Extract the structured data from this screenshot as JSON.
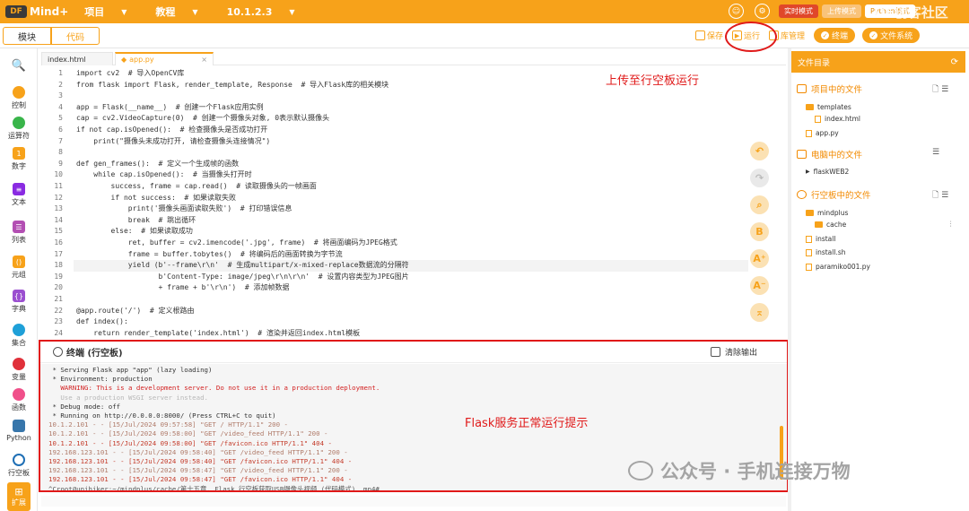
{
  "topbar": {
    "app_name": "Mind+",
    "logo_mark": "DF",
    "menu": [
      {
        "label": "项目"
      },
      {
        "label": "教程"
      },
      {
        "label": "10.1.2.3"
      }
    ],
    "modes": [
      "实时模式",
      "上传模式",
      "Python模式"
    ],
    "watermark": "DF创客社区"
  },
  "tabbar": {
    "tab_blocks": "模块",
    "tab_code": "代码",
    "save": "保存",
    "run": "运行",
    "library": "库管理",
    "connect_terminal": "终端",
    "file_system": "文件系统"
  },
  "sidebar": [
    {
      "label": "",
      "icon": "search-icon"
    },
    {
      "label": "控制",
      "color": "#f7a21a"
    },
    {
      "label": "运算符",
      "color": "#39b54a"
    },
    {
      "label": "数字",
      "color": "#f7a21a"
    },
    {
      "label": "文本",
      "color": "#8a2be2"
    },
    {
      "label": "列表",
      "color": "#b34fb3"
    },
    {
      "label": "元组",
      "color": "#f7a21a"
    },
    {
      "label": "字典",
      "color": "#9b4fd0"
    },
    {
      "label": "集合",
      "color": "#1fa0d8"
    },
    {
      "label": "变量",
      "color": "#e0303a"
    },
    {
      "label": "函数",
      "color": "#f0508a"
    },
    {
      "label": "Python",
      "color": "#3776ab"
    },
    {
      "label": "行空板",
      "color": "#1f6fb5"
    },
    {
      "label": "扩展"
    }
  ],
  "editor": {
    "tabs": [
      "index.html",
      "app.py"
    ],
    "code": [
      [
        "1",
        "import cv2  # 导入OpenCV库"
      ],
      [
        "2",
        "from flask import Flask, render_template, Response  # 导入Flask库的相关模块"
      ],
      [
        "3",
        ""
      ],
      [
        "4",
        "app = Flask(__name__)  # 创建一个Flask应用实例"
      ],
      [
        "5",
        "cap = cv2.VideoCapture(0)  # 创建一个摄像头对象, 0表示默认摄像头"
      ],
      [
        "6",
        "if not cap.isOpened():  # 检查摄像头是否成功打开"
      ],
      [
        "7",
        "    print(\"摄像头未成功打开, 请检查摄像头连接情况\")"
      ],
      [
        "8",
        ""
      ],
      [
        "9",
        "def gen_frames():  # 定义一个生成帧的函数"
      ],
      [
        "10",
        "    while cap.isOpened():  # 当摄像头打开时"
      ],
      [
        "11",
        "        success, frame = cap.read()  # 读取摄像头的一帧画面"
      ],
      [
        "12",
        "        if not success:  # 如果读取失败"
      ],
      [
        "13",
        "            print('摄像头画面读取失败')  # 打印错误信息"
      ],
      [
        "14",
        "            break  # 跳出循环"
      ],
      [
        "15",
        "        else:  # 如果读取成功"
      ],
      [
        "16",
        "            ret, buffer = cv2.imencode('.jpg', frame)  # 将画面编码为JPEG格式"
      ],
      [
        "17",
        "            frame = buffer.tobytes()  # 将编码后的画面转换为字节流"
      ],
      [
        "18",
        "            yield (b'--frame\\r\\n'  # 生成multipart/x-mixed-replace数据流的分隔符"
      ],
      [
        "19",
        "                   b'Content-Type: image/jpeg\\r\\n\\r\\n'  # 设置内容类型为JPEG图片"
      ],
      [
        "20",
        "                   + frame + b'\\r\\n')  # 添加帧数据"
      ],
      [
        "21",
        ""
      ],
      [
        "22",
        "@app.route('/')  # 定义根路由"
      ],
      [
        "23",
        "def index():"
      ],
      [
        "24",
        "    return render_template('index.html')  # 渲染并返回index.html模板"
      ]
    ]
  },
  "annotation_run": "上传至行空板运行",
  "annotation_flask": "Flask服务正常运行提示",
  "terminal": {
    "title": "终端 (行空板)",
    "clear": "清除输出",
    "lines": [
      [
        " * Serving Flask app \"app\" (lazy loading)",
        ""
      ],
      [
        " * Environment: production",
        ""
      ],
      [
        "   WARNING: This is a development server. Do not use it in a production deployment.",
        "red"
      ],
      [
        "   Use a production WSGI server instead.",
        "gray"
      ],
      [
        " * Debug mode: off",
        ""
      ],
      [
        " * Running on http://0.0.0.0:8000/ (Press CTRL+C to quit)",
        ""
      ],
      [
        "10.1.2.101 - - [15/Jul/2024 09:57:58] \"GET / HTTP/1.1\" 200 -",
        "mix"
      ],
      [
        "10.1.2.101 - - [15/Jul/2024 09:58:00] \"GET /video_feed HTTP/1.1\" 200 -",
        "mix"
      ],
      [
        "10.1.2.101 - - [15/Jul/2024 09:58:00] \"GET /favicon.ico HTTP/1.1\" 404 -",
        "mixr"
      ],
      [
        "192.168.123.101 - - [15/Jul/2024 09:58:40] \"GET /video_feed HTTP/1.1\" 200 -",
        "mix"
      ],
      [
        "192.168.123.101 - - [15/Jul/2024 09:58:40] \"GET /favicon.ico HTTP/1.1\" 404 -",
        "mixr"
      ],
      [
        "192.168.123.101 - - [15/Jul/2024 09:58:47] \"GET /video_feed HTTP/1.1\" 200 -",
        "mix"
      ],
      [
        "192.168.123.101 - - [15/Jul/2024 09:58:47] \"GET /favicon.ico HTTP/1.1\" 404 -",
        "mixr"
      ],
      [
        "^Croot@unihiker:~/mindplus/cache/第十五章. Flask 行空板获取USB摄像头视频 (代码模式) .mp4#",
        ""
      ]
    ]
  },
  "files": {
    "title": "文件目录",
    "sections": [
      {
        "label": "项目中的文件"
      },
      {
        "label": "电脑中的文件"
      },
      {
        "label": "行空板中的文件"
      }
    ],
    "project_items": [
      "templates",
      "index.html",
      "app.py"
    ],
    "pc_items": [
      "flaskWEB2"
    ],
    "board_items": [
      "mindplus",
      "cache",
      "install",
      "install.sh",
      "paramiko001.py"
    ]
  },
  "watermark": "公众号 · 手机连接万物"
}
